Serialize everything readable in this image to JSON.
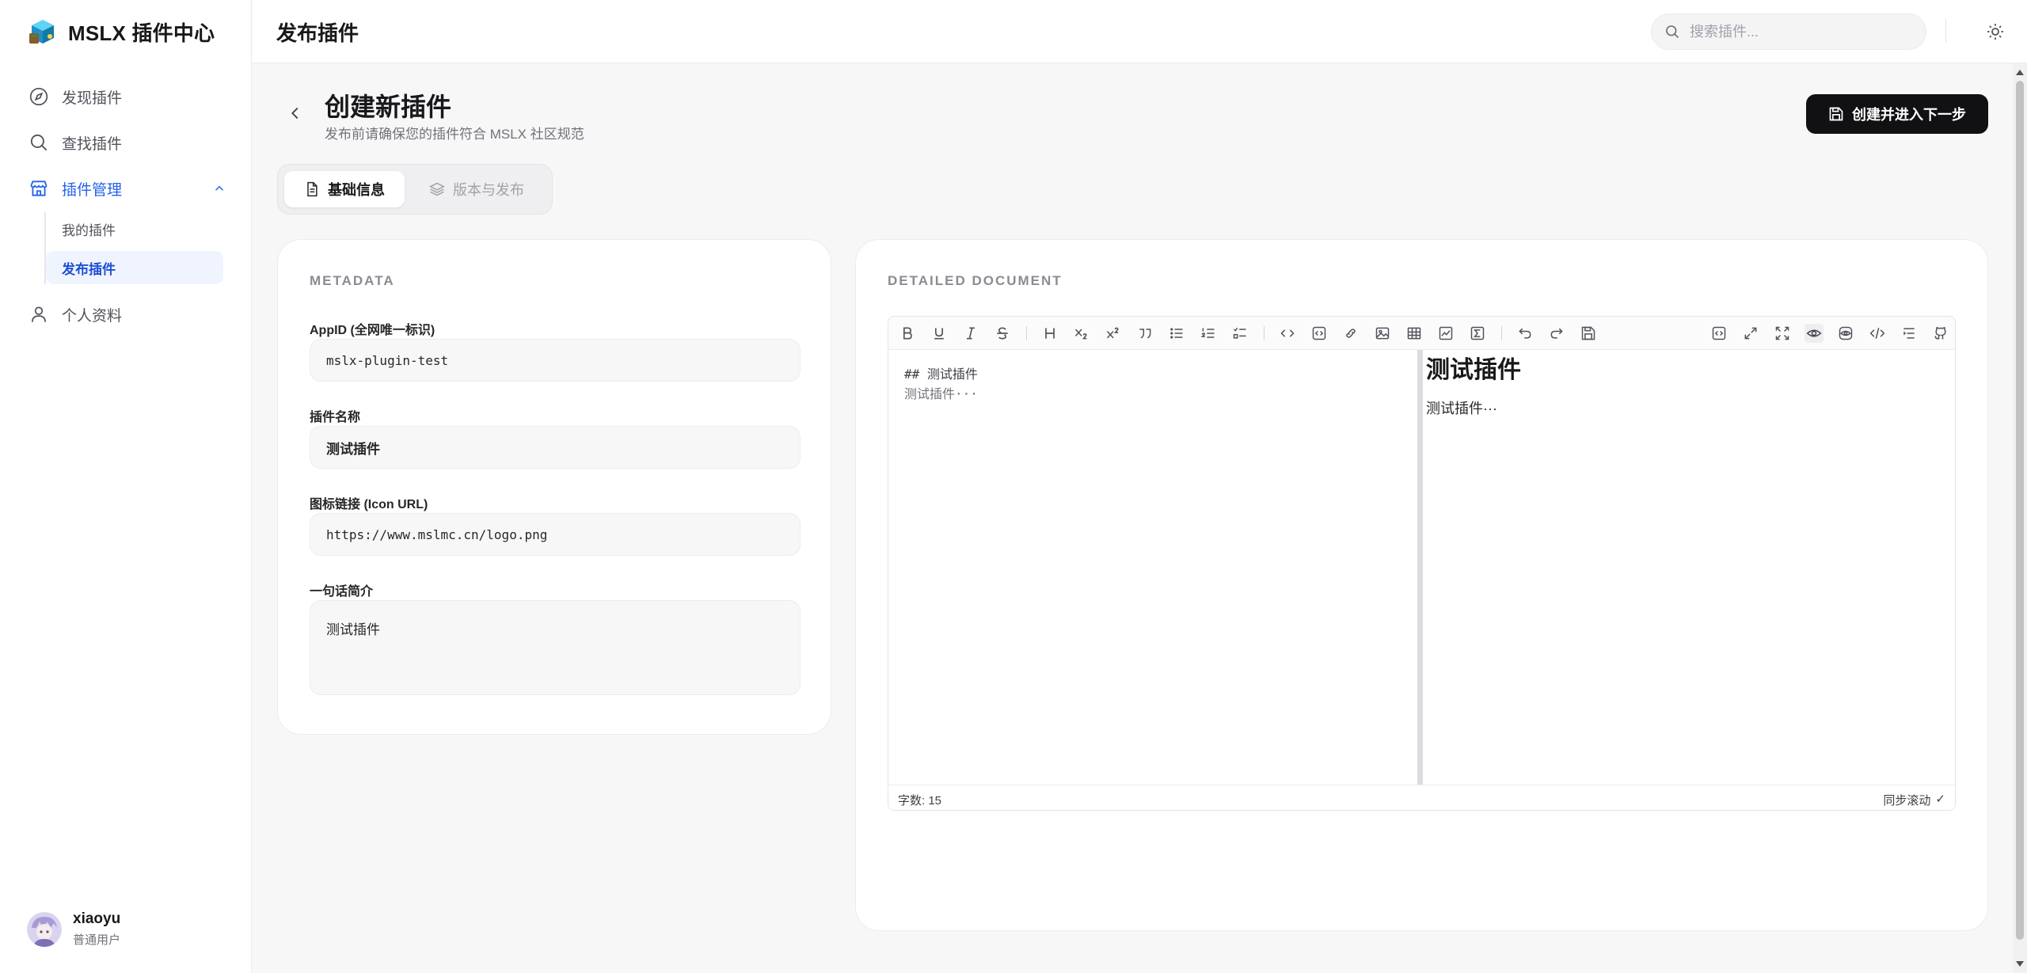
{
  "brand": {
    "title": "MSLX 插件中心",
    "logo_icon": "cube-logo-icon"
  },
  "sidebar": {
    "items": [
      {
        "label": "发现插件",
        "icon": "compass-icon"
      },
      {
        "label": "查找插件",
        "icon": "search-icon"
      },
      {
        "label": "插件管理",
        "icon": "store-icon",
        "expanded": true,
        "children": [
          {
            "label": "我的插件"
          },
          {
            "label": "发布插件",
            "active": true
          }
        ]
      },
      {
        "label": "个人资料",
        "icon": "user-icon"
      }
    ],
    "user": {
      "name": "xiaoyu",
      "role": "普通用户"
    }
  },
  "topbar": {
    "title": "发布插件",
    "search_placeholder": "搜索插件...",
    "theme_icon": "sun-icon"
  },
  "header": {
    "title": "创建新插件",
    "subtitle": "发布前请确保您的插件符合 MSLX 社区规范",
    "primary_button": "创建并进入下一步"
  },
  "tabs": [
    {
      "label": "基础信息",
      "active": true,
      "icon": "document-icon"
    },
    {
      "label": "版本与发布",
      "active": false,
      "icon": "layers-icon"
    }
  ],
  "metadata": {
    "section_label": "METADATA",
    "fields": {
      "appid": {
        "label": "AppID (全网唯一标识)",
        "value": "mslx-plugin-test"
      },
      "name": {
        "label": "插件名称",
        "value": "测试插件"
      },
      "icon_url": {
        "label": "图标链接 (Icon URL)",
        "value": "https://www.mslmc.cn/logo.png"
      },
      "summary": {
        "label": "一句话简介",
        "value": "测试插件"
      }
    }
  },
  "document": {
    "section_label": "DETAILED DOCUMENT",
    "source_line1": "## 测试插件",
    "source_line2": "测试插件···",
    "preview_heading": "测试插件",
    "preview_text": "测试插件···",
    "word_count": "字数: 15",
    "sync_scroll": "同步滚动",
    "sync_check": "✓"
  },
  "colors": {
    "accent": "#2563eb",
    "active_bg": "#eff4ff",
    "primary_button_bg": "#111113"
  }
}
